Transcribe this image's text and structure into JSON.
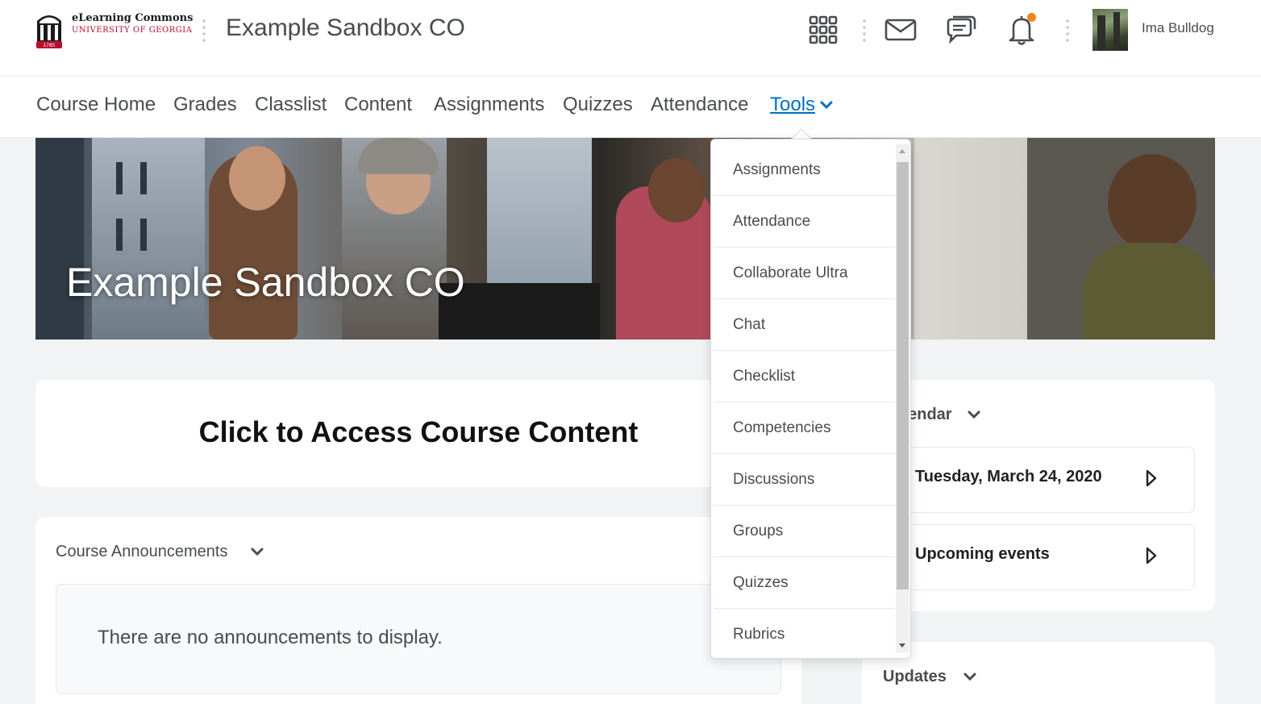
{
  "header": {
    "logo_line1": "eLearning Commons",
    "logo_line2": "UNIVERSITY OF GEORGIA",
    "logo_year": "1785",
    "course_title": "Example Sandbox CO",
    "icons": [
      "waffle-icon",
      "mail-icon",
      "chat-icon",
      "bell-icon"
    ],
    "user_name": "Ima Bulldog"
  },
  "nav": {
    "items": [
      "Course Home",
      "Grades",
      "Classlist",
      "Content",
      "Assignments",
      "Quizzes",
      "Attendance"
    ],
    "tools_label": "Tools"
  },
  "banner": {
    "title": "Example Sandbox CO"
  },
  "main": {
    "access_title": "Click to Access Course Content",
    "announcements_title": "Course Announcements",
    "announcements_empty": "There are no announcements to display."
  },
  "sidebar": {
    "calendar_title": "Calendar",
    "calendar_date": "Tuesday, March 24, 2020",
    "upcoming_events": "Upcoming events",
    "updates_title": "Updates"
  },
  "tools_menu": {
    "items": [
      "Assignments",
      "Attendance",
      "Collaborate Ultra",
      "Chat",
      "Checklist",
      "Competencies",
      "Discussions",
      "Groups",
      "Quizzes",
      "Rubrics"
    ]
  },
  "colors": {
    "accent": "#006fbf",
    "notification": "#f58220",
    "brand_red": "#ba0c2f",
    "text": "#494c4e"
  }
}
